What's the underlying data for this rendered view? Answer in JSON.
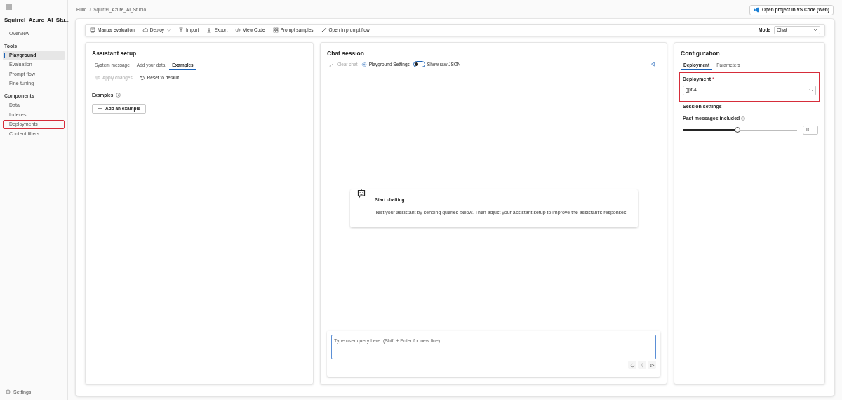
{
  "sidebar": {
    "project": "Squirrel_Azure_AI_Stu...",
    "top_items": [
      {
        "label": "Overview",
        "selected": false,
        "highlighted": false
      }
    ],
    "sections": [
      {
        "heading": "Tools",
        "items": [
          {
            "label": "Playground",
            "selected": true,
            "highlighted": false
          },
          {
            "label": "Evaluation",
            "selected": false,
            "highlighted": false
          },
          {
            "label": "Prompt flow",
            "selected": false,
            "highlighted": false
          },
          {
            "label": "Fine-tuning",
            "selected": false,
            "highlighted": false
          }
        ]
      },
      {
        "heading": "Components",
        "items": [
          {
            "label": "Data",
            "selected": false,
            "highlighted": false
          },
          {
            "label": "Indexes",
            "selected": false,
            "highlighted": false
          },
          {
            "label": "Deployments",
            "selected": false,
            "highlighted": true
          },
          {
            "label": "Content filters",
            "selected": false,
            "highlighted": false
          }
        ]
      }
    ],
    "footer": "Settings"
  },
  "breadcrumb": {
    "items": [
      "Build",
      "Squirrel_Azure_AI_Studio"
    ],
    "separator": "/"
  },
  "vscode_button": "Open project in VS Code (Web)",
  "toolbar": {
    "items": [
      {
        "kind": "evaluation",
        "label": "Manual evaluation",
        "caret": false
      },
      {
        "kind": "cloud",
        "label": "Deploy",
        "caret": true
      },
      {
        "kind": "import",
        "label": "Import",
        "caret": false
      },
      {
        "kind": "export",
        "label": "Export",
        "caret": false
      },
      {
        "kind": "code",
        "label": "View Code",
        "caret": false
      },
      {
        "kind": "grid",
        "label": "Prompt samples",
        "caret": false
      },
      {
        "kind": "flow",
        "label": "Open in prompt flow",
        "caret": false
      }
    ],
    "mode": {
      "label": "Mode",
      "value": "Chat"
    }
  },
  "assistant_setup": {
    "title": "Assistant setup",
    "tabs": [
      {
        "label": "System message",
        "selected": false
      },
      {
        "label": "Add your data",
        "selected": false
      },
      {
        "label": "Examples",
        "selected": true
      }
    ],
    "actions": [
      {
        "kind": "apply",
        "label": "Apply changes",
        "disabled": true
      },
      {
        "kind": "reset",
        "label": "Reset to default",
        "disabled": false
      }
    ],
    "examples_label": "Examples",
    "add_button": "Add an example"
  },
  "chat_session": {
    "title": "Chat session",
    "actions": [
      {
        "kind": "clear",
        "label": "Clear chat",
        "disabled": true
      },
      {
        "kind": "settings",
        "label": "Playground Settings",
        "disabled": false
      }
    ],
    "toggle": {
      "label": "Show raw JSON",
      "on": false
    },
    "empty_state": {
      "title": "Start chatting",
      "text": "Test your assistant by sending queries below. Then adjust your assistant setup to improve the assistant's responses."
    },
    "input": {
      "placeholder": "Type user query here. (Shift + Enter for new line)"
    }
  },
  "configuration": {
    "title": "Configuration",
    "tabs": [
      {
        "label": "Deployment",
        "selected": true
      },
      {
        "label": "Parameters",
        "selected": false
      }
    ],
    "deployment": {
      "label": "Deployment",
      "required_marker": "*",
      "value": "gpt-4",
      "highlighted": true
    },
    "session_heading": "Session settings",
    "slider": {
      "label": "Past messages included",
      "level": 0.48,
      "value": "10"
    }
  }
}
